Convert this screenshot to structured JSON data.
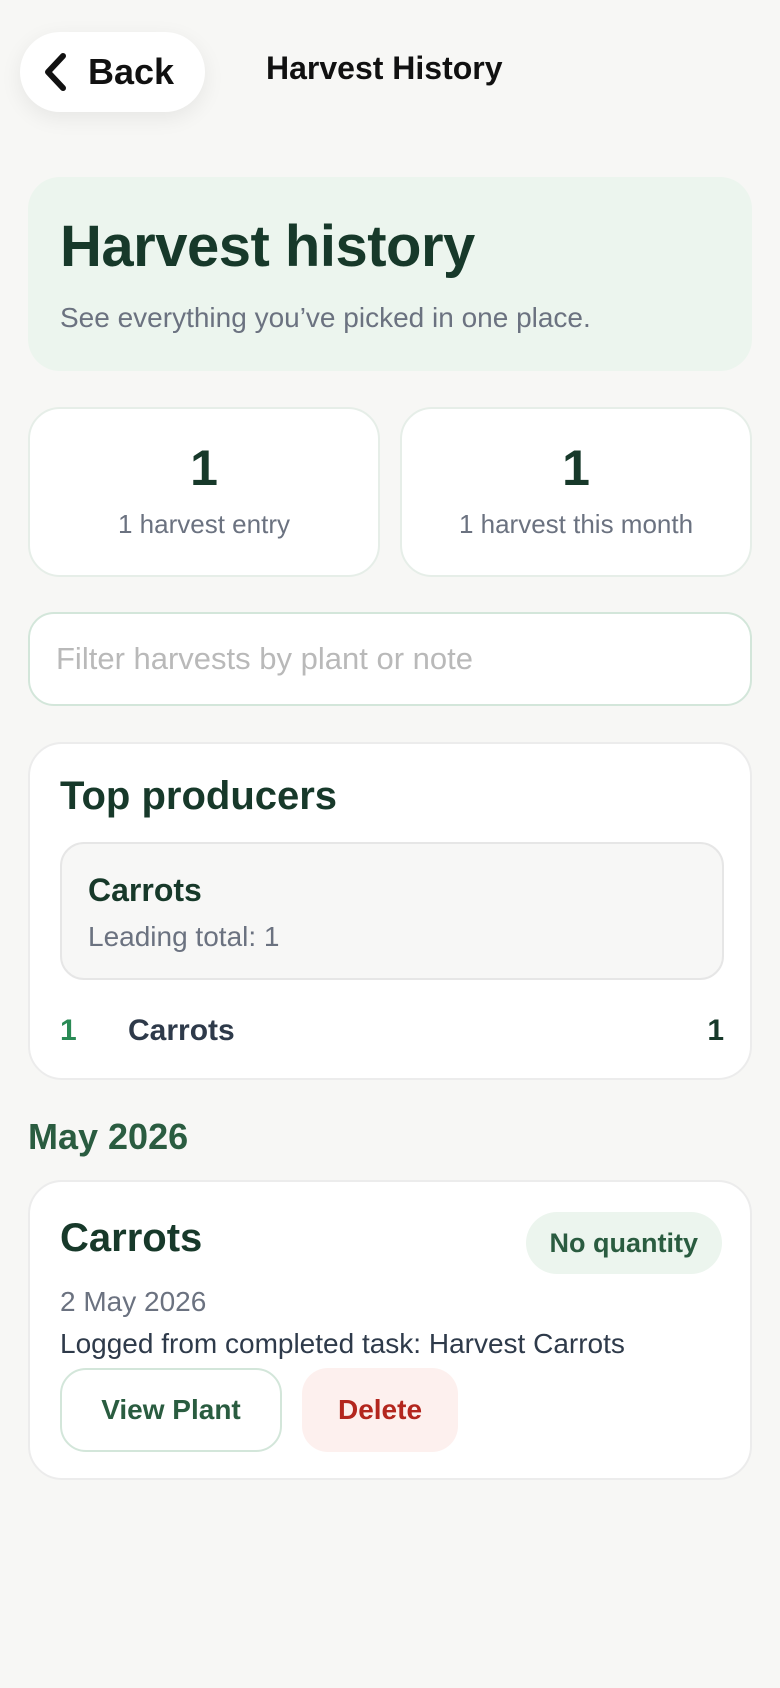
{
  "nav": {
    "back_label": "Back",
    "title": "Harvest History",
    "back_icon": "chevron-left-icon"
  },
  "hero": {
    "title": "Harvest history",
    "subtitle": "See everything you’ve picked in one place."
  },
  "stats": [
    {
      "value": "1",
      "label": "1 harvest entry"
    },
    {
      "value": "1",
      "label": "1 harvest this month"
    }
  ],
  "filter": {
    "placeholder": "Filter harvests by plant or note",
    "value": ""
  },
  "top_producers": {
    "title": "Top producers",
    "leader": {
      "name": "Carrots",
      "total_text": "Leading total: 1"
    },
    "rows": [
      {
        "rank": "1",
        "name": "Carrots",
        "value": "1"
      }
    ]
  },
  "month_group": {
    "heading": "May 2026",
    "entries": [
      {
        "plant": "Carrots",
        "quantity_badge": "No quantity",
        "date": "2 May 2026",
        "note": "Logged from completed task: Harvest Carrots",
        "view_label": "View Plant",
        "delete_label": "Delete"
      }
    ]
  },
  "colors": {
    "background": "#f7f7f5",
    "primary_dark_green": "#17392a",
    "accent_green": "#2a8a55",
    "hero_bg": "#ecf5ee",
    "danger": "#b3261e",
    "danger_bg": "#fdf0ee"
  }
}
